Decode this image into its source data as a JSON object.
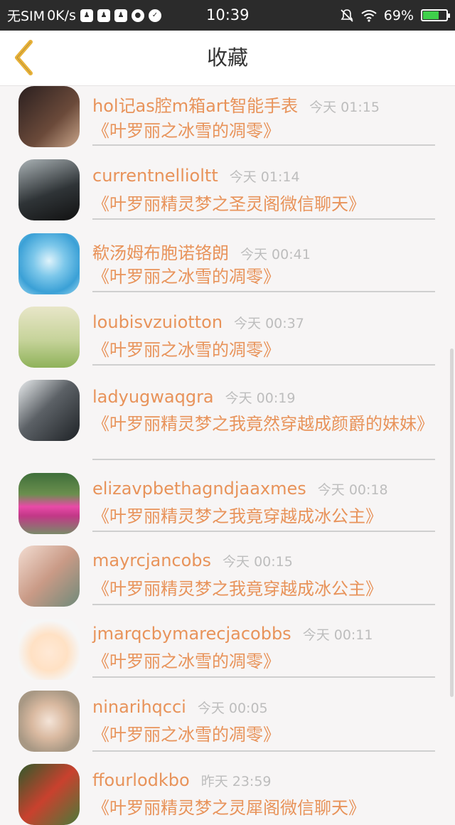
{
  "status": {
    "carrier": "无SIM",
    "speed": "0K/s",
    "time": "10:39",
    "battery": "69%",
    "battery_level": 0.69,
    "left_icons": [
      "qq-icon",
      "qq-icon",
      "qq-icon",
      "wechat-icon",
      "check-icon"
    ],
    "right_icons": [
      "mute-icon",
      "wifi-icon",
      "battery-icon"
    ]
  },
  "nav": {
    "title": "收藏",
    "back_icon": "chevron-left-icon",
    "accent": "#e8b23a"
  },
  "colors": {
    "name": "#e8935a",
    "time": "#bdbdbd"
  },
  "items": [
    {
      "name": "hol记as腔m箱art智能手表",
      "time": "今天 01:15",
      "title": "《叶罗丽之冰雪的凋零》"
    },
    {
      "name": "currentnellioltt",
      "time": "今天 01:14",
      "title": "《叶罗丽精灵梦之圣灵阁微信聊天》"
    },
    {
      "name": "欷汤姆布胞诺铬朗",
      "time": "今天 00:41",
      "title": "《叶罗丽之冰雪的凋零》"
    },
    {
      "name": "loubisvzuiotton",
      "time": "今天 00:37",
      "title": "《叶罗丽之冰雪的凋零》"
    },
    {
      "name": "ladyugwaqgra",
      "time": "今天 00:19",
      "title": "《叶罗丽精灵梦之我竟然穿越成颜爵的妹妹》"
    },
    {
      "name": "elizavpbethagndjaaxmes",
      "time": "今天 00:18",
      "title": "《叶罗丽精灵梦之我竟穿越成冰公主》"
    },
    {
      "name": "mayrcjancobs",
      "time": "今天 00:15",
      "title": "《叶罗丽精灵梦之我竟穿越成冰公主》"
    },
    {
      "name": "jmarqcbymarecjacobbs",
      "time": "今天 00:11",
      "title": "《叶罗丽之冰雪的凋零》"
    },
    {
      "name": "ninarihqcci",
      "time": "今天 00:05",
      "title": "《叶罗丽之冰雪的凋零》"
    },
    {
      "name": "ffourlodkbo",
      "time": "昨天 23:59",
      "title": "《叶罗丽精灵梦之灵犀阁微信聊天》"
    }
  ]
}
